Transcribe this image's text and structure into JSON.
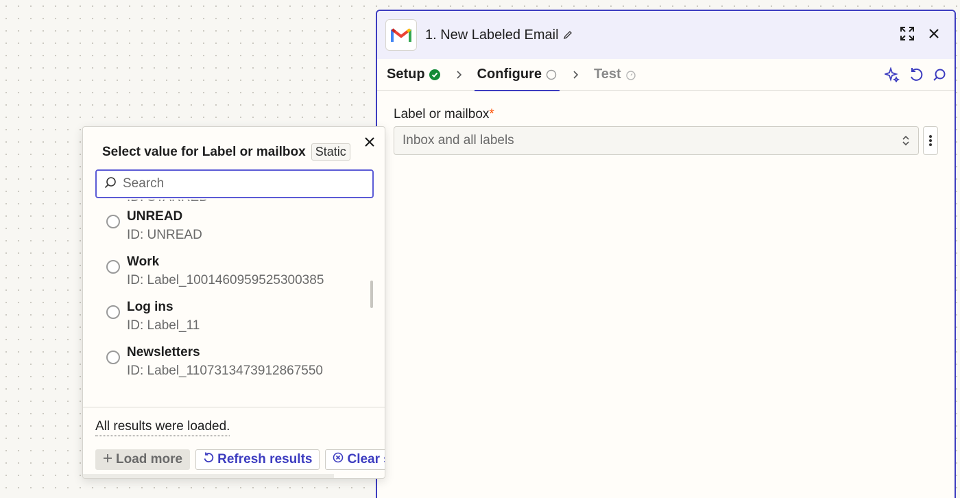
{
  "panel": {
    "title": "1. New Labeled Email",
    "tabs": [
      {
        "label": "Setup",
        "status": "complete"
      },
      {
        "label": "Configure",
        "status": "in-progress"
      },
      {
        "label": "Test",
        "status": "pending"
      }
    ],
    "field": {
      "label": "Label or mailbox",
      "required_mark": "*",
      "placeholder": "Inbox and all labels"
    }
  },
  "popover": {
    "title": "Select value for Label or mailbox",
    "badge": "Static",
    "search_placeholder": "Search",
    "cut_off_text": "ID: STARRED",
    "options": [
      {
        "name": "UNREAD",
        "id": "ID: UNREAD"
      },
      {
        "name": "Work",
        "id": "ID: Label_1001460959525300385"
      },
      {
        "name": "Log ins",
        "id": "ID: Label_11"
      },
      {
        "name": "Newsletters",
        "id": "ID: Label_1107313473912867550"
      }
    ],
    "status_text": "All results were loaded.",
    "buttons": {
      "load_more": "Load more",
      "refresh": "Refresh results",
      "clear": "Clear s"
    }
  },
  "colors": {
    "accent": "#3d3dc0",
    "required": "#ff4f00",
    "success": "#138a36"
  },
  "icons": [
    "gmail-icon",
    "pencil-icon",
    "expand-icon",
    "close-icon",
    "check-circle-icon",
    "pending-circle-icon",
    "timer-icon",
    "sparkle-icon",
    "undo-icon",
    "search-icon",
    "updown-icon",
    "kebab-icon",
    "plus-icon",
    "refresh-icon",
    "clear-icon"
  ]
}
